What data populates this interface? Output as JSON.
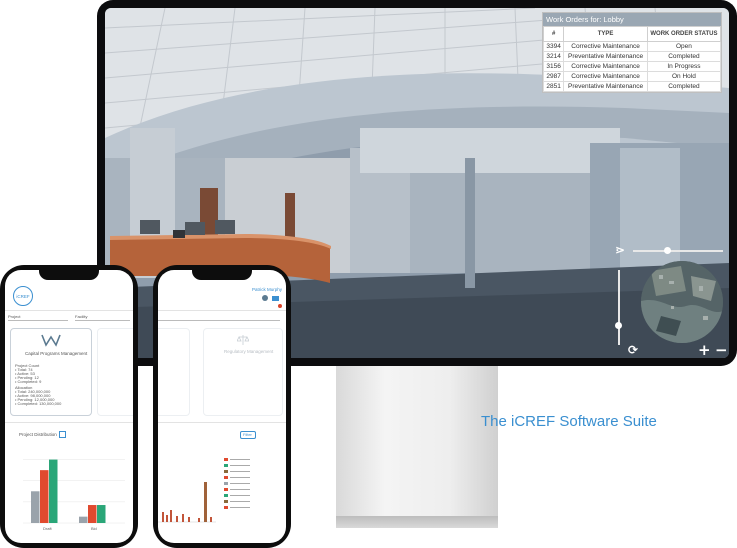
{
  "work_orders": {
    "title": "Work Orders for: Lobby",
    "columns": [
      "#",
      "TYPE",
      "WORK ORDER STATUS"
    ],
    "rows": [
      [
        "3394",
        "Corrective Maintenance",
        "Open"
      ],
      [
        "3214",
        "Preventative Maintenance",
        "Completed"
      ],
      [
        "3156",
        "Corrective Maintenance",
        "In Progress"
      ],
      [
        "2987",
        "Corrective Maintenance",
        "On Hold"
      ],
      [
        "2851",
        "Preventative Maintenance",
        "Completed"
      ]
    ]
  },
  "viewer": {
    "rotate_symbol": "⟳",
    "zoom_in": "+",
    "zoom_out": "−",
    "arrow": "⋗"
  },
  "tagline": "The iCREF Software Suite",
  "phone_left": {
    "logo": "iCREF",
    "filter_label_1": "Project",
    "filter_label_2": "Facility",
    "card_title": "Capital Programs Management",
    "card_lines": [
      "Project Count",
      "• Total: 74",
      "• Active: 53",
      "• Pending: 12",
      "• Completed: 9",
      "Allocation",
      "• Total: 240,000,000",
      "• Active: 98,000,000",
      "• Pending: 12,000,000",
      "• Completed: 130,000,000"
    ],
    "section_title": "Project Distribution",
    "bar_labels": [
      "Draft",
      "Bid"
    ]
  },
  "phone_right": {
    "user": "Patrick Murphy",
    "card_title": "Regulatory Management",
    "button": "Filter"
  },
  "colors": {
    "accent": "#3a8fd0",
    "bar_gray": "#9aa3ab",
    "bar_red": "#e04a2f",
    "bar_green": "#2aa678"
  },
  "chart_data": {
    "type": "bar",
    "categories": [
      "Draft",
      "Bid"
    ],
    "series": [
      {
        "values": [
          150,
          30
        ]
      },
      {
        "values": [
          250,
          85
        ]
      },
      {
        "values": [
          300,
          85
        ]
      }
    ],
    "ylim": [
      0,
      350
    ]
  }
}
